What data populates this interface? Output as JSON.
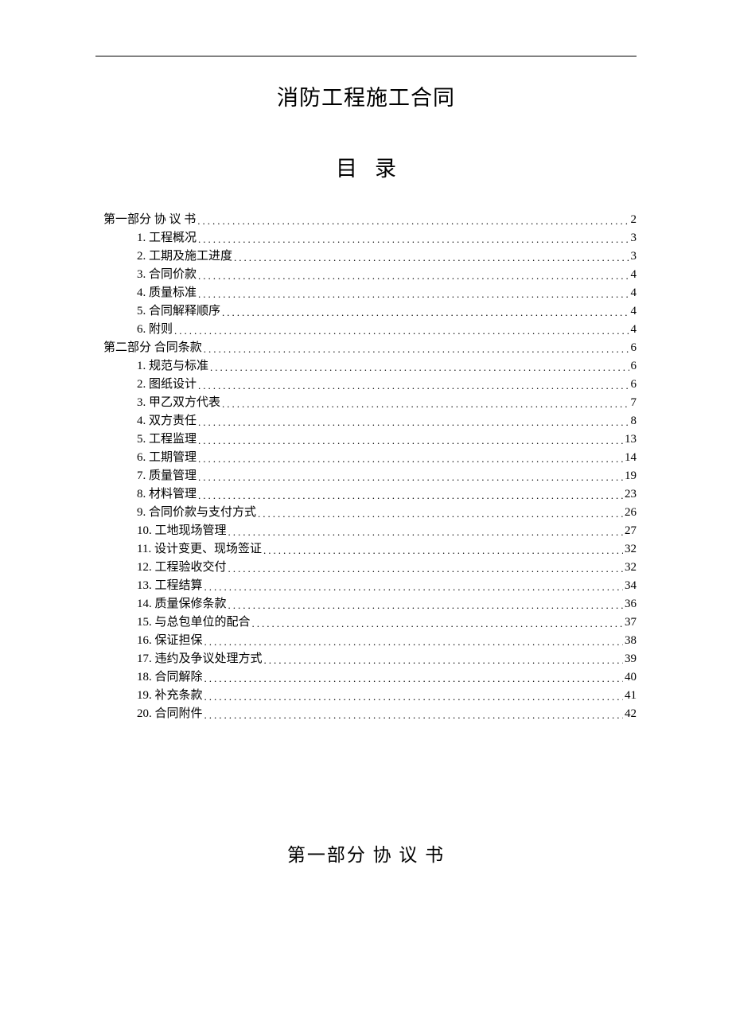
{
  "title": "消防工程施工合同",
  "toc_heading": "目　录",
  "section_heading": "第一部分 协 议 书",
  "toc": [
    {
      "level": 0,
      "label": "第一部分 协 议 书",
      "page": "2"
    },
    {
      "level": 1,
      "label": "1. 工程概况",
      "page": "3"
    },
    {
      "level": 1,
      "label": "2. 工期及施工进度",
      "page": "3"
    },
    {
      "level": 1,
      "label": "3. 合同价款",
      "page": "4"
    },
    {
      "level": 1,
      "label": "4. 质量标准",
      "page": "4"
    },
    {
      "level": 1,
      "label": "5. 合同解释顺序",
      "page": "4"
    },
    {
      "level": 1,
      "label": "6. 附则",
      "page": "4"
    },
    {
      "level": 0,
      "label": "第二部分  合同条款",
      "page": "6"
    },
    {
      "level": 1,
      "label": "1. 规范与标准",
      "page": "6"
    },
    {
      "level": 1,
      "label": "2. 图纸设计",
      "page": "6"
    },
    {
      "level": 1,
      "label": "3. 甲乙双方代表",
      "page": "7"
    },
    {
      "level": 1,
      "label": "4. 双方责任",
      "page": "8"
    },
    {
      "level": 1,
      "label": "5. 工程监理",
      "page": "13"
    },
    {
      "level": 1,
      "label": "6. 工期管理",
      "page": "14"
    },
    {
      "level": 1,
      "label": "7. 质量管理",
      "page": "19"
    },
    {
      "level": 1,
      "label": "8. 材料管理",
      "page": "23"
    },
    {
      "level": 1,
      "label": "9. 合同价款与支付方式",
      "page": "26"
    },
    {
      "level": 1,
      "label": "10. 工地现场管理",
      "page": "27"
    },
    {
      "level": 1,
      "label": "11. 设计变更、现场签证",
      "page": "32"
    },
    {
      "level": 1,
      "label": "12. 工程验收交付",
      "page": "32"
    },
    {
      "level": 1,
      "label": "13. 工程结算",
      "page": "34"
    },
    {
      "level": 1,
      "label": "14. 质量保修条款",
      "page": "36"
    },
    {
      "level": 1,
      "label": "15. 与总包单位的配合",
      "page": "37"
    },
    {
      "level": 1,
      "label": "16. 保证担保",
      "page": "38"
    },
    {
      "level": 1,
      "label": "17. 违约及争议处理方式",
      "page": "39"
    },
    {
      "level": 1,
      "label": "18. 合同解除",
      "page": "40"
    },
    {
      "level": 1,
      "label": "19. 补充条款",
      "page": "41"
    },
    {
      "level": 1,
      "label": "20. 合同附件",
      "page": "42"
    }
  ]
}
